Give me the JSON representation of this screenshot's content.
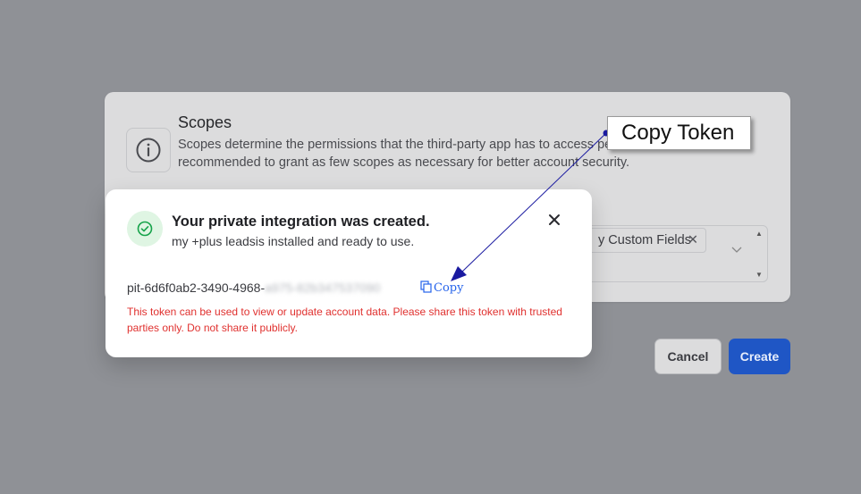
{
  "background": {
    "scopes_title": "Scopes",
    "scopes_description": "Scopes determine the permissions that the third-party app has to access perform actions. It's recommended to grant as few scopes as necessary for better account security.",
    "scope_tag": "y Custom Fields",
    "cancel_label": "Cancel",
    "create_label": "Create"
  },
  "modal": {
    "title": "Your private integration was created.",
    "subtitle": "my +plus leadsis installed and ready to use.",
    "token_visible": "pit-6d6f0ab2-3490-4968-",
    "token_hidden": "a975-82b347537090",
    "copy_label": "Copy",
    "warning": "This token can be used to view or update account data. Please share this token with trusted parties only. Do not share it publicly."
  },
  "annotation": {
    "label": "Copy Token"
  },
  "colors": {
    "overlay": "#8f9196",
    "primary": "#1f56c5",
    "success": "#16a34a",
    "danger": "#e0312f",
    "link": "#2563eb",
    "arrow": "#1a1aa0"
  }
}
